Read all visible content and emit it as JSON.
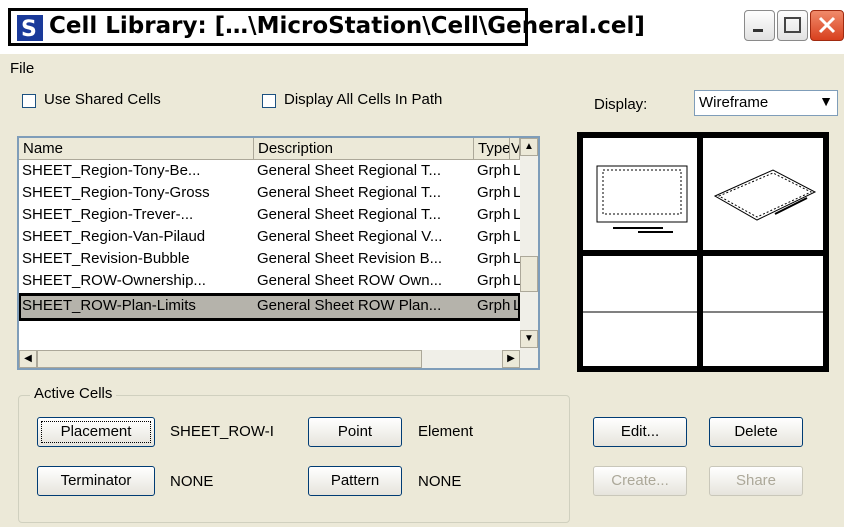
{
  "window": {
    "title": "Cell Library: […\\MicroStation\\Cell\\General.cel]",
    "icon": "microstation-icon"
  },
  "menu": {
    "file_label": "File"
  },
  "options": {
    "use_shared_cells_label": "Use Shared Cells",
    "use_shared_cells_checked": false,
    "display_all_label": "Display All Cells In Path",
    "display_all_checked": false,
    "display_label": "Display:",
    "display_value": "Wireframe"
  },
  "list": {
    "columns": [
      "Name",
      "Description",
      "Type",
      "V"
    ],
    "rows": [
      {
        "name": "SHEET_Region-Tony-Be...",
        "description": "General Sheet Regional T...",
        "type": "Grph",
        "v": "L"
      },
      {
        "name": "SHEET_Region-Tony-Gross",
        "description": "General Sheet Regional T...",
        "type": "Grph",
        "v": "L"
      },
      {
        "name": "SHEET_Region-Trever-...",
        "description": "General Sheet Regional T...",
        "type": "Grph",
        "v": "L"
      },
      {
        "name": "SHEET_Region-Van-Pilaud",
        "description": "General Sheet Regional V...",
        "type": "Grph",
        "v": "L"
      },
      {
        "name": "SHEET_Revision-Bubble",
        "description": "General Sheet Revision B...",
        "type": "Grph",
        "v": "L"
      },
      {
        "name": "SHEET_ROW-Ownership...",
        "description": "General Sheet ROW Own...",
        "type": "Grph",
        "v": "L"
      },
      {
        "name": "SHEET_ROW-Plan-Limits",
        "description": "General Sheet ROW Plan...",
        "type": "Grph",
        "v": "L"
      }
    ],
    "selected_index": 6
  },
  "active_cells": {
    "group_label": "Active Cells",
    "placement_button": "Placement",
    "placement_value": "SHEET_ROW-I",
    "point_button": "Point",
    "point_value": "Element",
    "terminator_button": "Terminator",
    "terminator_value": "NONE",
    "pattern_button": "Pattern",
    "pattern_value": "NONE"
  },
  "actions": {
    "edit": "Edit...",
    "delete": "Delete",
    "create": "Create...",
    "share": "Share"
  },
  "colors": {
    "window_bg": "#ECE9D8",
    "selection_bg": "#B5B3AB",
    "close_button": "#D8401E"
  }
}
